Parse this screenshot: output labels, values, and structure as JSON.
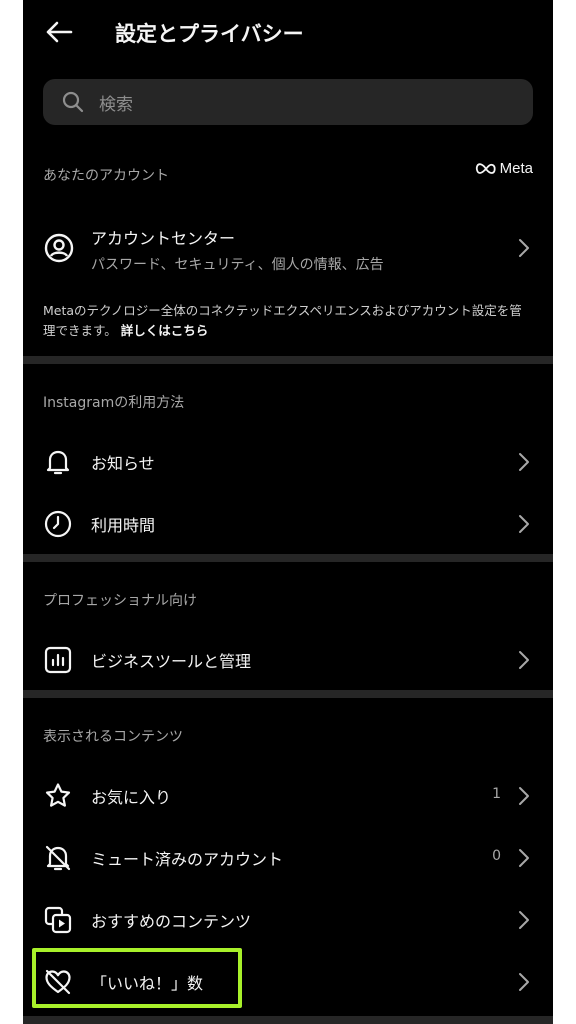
{
  "header": {
    "title": "設定とプライバシー"
  },
  "search": {
    "placeholder": "検索"
  },
  "account_section": {
    "title": "あなたのアカウント",
    "brand": "Meta",
    "account_center": {
      "label": "アカウントセンター",
      "sublabel": "パスワード、セキュリティ、個人の情報、広告"
    },
    "description": "Metaのテクノロジー全体のコネクテッドエクスペリエンスおよびアカウント設定を管理できます。",
    "link": "詳しくはこちら"
  },
  "usage_section": {
    "title": "Instagramの利用方法",
    "items": [
      {
        "label": "お知らせ",
        "icon": "bell-icon"
      },
      {
        "label": "利用時間",
        "icon": "clock-icon"
      }
    ]
  },
  "pro_section": {
    "title": "プロフェッショナル向け",
    "items": [
      {
        "label": "ビジネスツールと管理",
        "icon": "insights-chart-icon"
      }
    ]
  },
  "content_section": {
    "title": "表示されるコンテンツ",
    "items": [
      {
        "label": "お気に入り",
        "count": "1",
        "icon": "star-icon"
      },
      {
        "label": "ミュート済みのアカウント",
        "count": "0",
        "icon": "muted-bell-icon"
      },
      {
        "label": "おすすめのコンテンツ",
        "icon": "suggested-content-icon"
      },
      {
        "label": "「いいね！」数",
        "icon": "hidden-like-icon"
      }
    ]
  },
  "colors": {
    "background": "#000000",
    "divider": "#262626",
    "highlight": "#a8f02a",
    "secondary_text": "#a8a8a8"
  }
}
